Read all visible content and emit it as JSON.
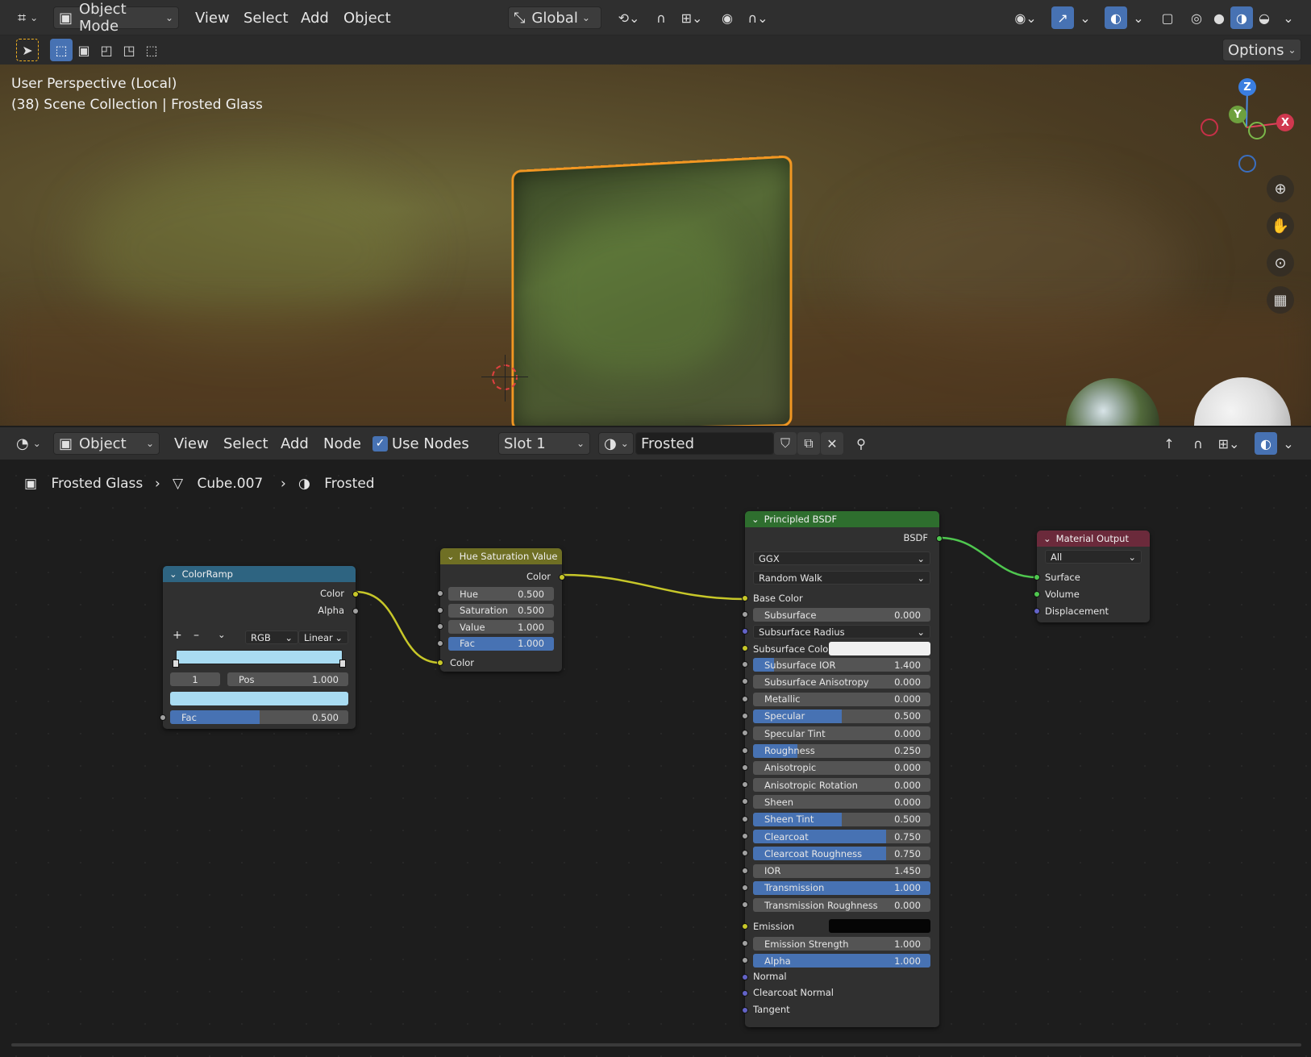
{
  "viewport_header": {
    "mode_label": "Object Mode",
    "menus": [
      "View",
      "Select",
      "Add",
      "Object"
    ],
    "orientation_label": "Global",
    "options_label": "Options"
  },
  "viewport": {
    "overlay_line1": "User Perspective (Local)",
    "overlay_line2": "(38) Scene Collection | Frosted Glass",
    "gizmo": {
      "z": "Z",
      "y": "Y",
      "x": "X"
    },
    "selection_color": "#f29722"
  },
  "node_editor_header": {
    "object_label": "Object",
    "menus": [
      "View",
      "Select",
      "Add",
      "Node"
    ],
    "use_nodes_label": "Use Nodes",
    "use_nodes_checked": true,
    "slot_label": "Slot 1",
    "material_name": "Frosted"
  },
  "breadcrumb": {
    "object": "Frosted Glass",
    "mesh": "Cube.007",
    "material": "Frosted"
  },
  "nodes": {
    "colorramp": {
      "title": "ColorRamp",
      "out_color": "Color",
      "out_alpha": "Alpha",
      "add": "+",
      "remove": "–",
      "color_mode": "RGB",
      "interpolation": "Linear",
      "stop_index": "1",
      "pos_label": "Pos",
      "pos_value": "1.000",
      "ramp_color": "#a9dcf2",
      "fac_label": "Fac",
      "fac_value": "0.500",
      "fac_fill": 0.5
    },
    "hsv": {
      "title": "Hue Saturation Value",
      "out_color": "Color",
      "fields": [
        {
          "label": "Hue",
          "value": "0.500",
          "fill": 0
        },
        {
          "label": "Saturation",
          "value": "0.500",
          "fill": 0
        },
        {
          "label": "Value",
          "value": "1.000",
          "fill": 0
        },
        {
          "label": "Fac",
          "value": "1.000",
          "fill": 1
        }
      ],
      "in_color": "Color"
    },
    "bsdf": {
      "title": "Principled BSDF",
      "out": "BSDF",
      "distribution": "GGX",
      "subsurface_method": "Random Walk",
      "base_color": "Base Color",
      "subsurface": {
        "label": "Subsurface",
        "value": "0.000",
        "fill": 0
      },
      "subsurface_radius": "Subsurface Radius",
      "subsurface_color": "Subsurface Color",
      "fields": [
        {
          "label": "Subsurface IOR",
          "value": "1.400",
          "fill": 0.12
        },
        {
          "label": "Subsurface Anisotropy",
          "value": "0.000",
          "fill": 0
        },
        {
          "label": "Metallic",
          "value": "0.000",
          "fill": 0
        },
        {
          "label": "Specular",
          "value": "0.500",
          "fill": 0.5
        },
        {
          "label": "Specular Tint",
          "value": "0.000",
          "fill": 0
        },
        {
          "label": "Roughness",
          "value": "0.250",
          "fill": 0.25
        },
        {
          "label": "Anisotropic",
          "value": "0.000",
          "fill": 0
        },
        {
          "label": "Anisotropic Rotation",
          "value": "0.000",
          "fill": 0
        },
        {
          "label": "Sheen",
          "value": "0.000",
          "fill": 0
        },
        {
          "label": "Sheen Tint",
          "value": "0.500",
          "fill": 0.5
        },
        {
          "label": "Clearcoat",
          "value": "0.750",
          "fill": 0.75
        },
        {
          "label": "Clearcoat Roughness",
          "value": "0.750",
          "fill": 0.75
        },
        {
          "label": "IOR",
          "value": "1.450",
          "fill": 0
        },
        {
          "label": "Transmission",
          "value": "1.000",
          "fill": 1
        },
        {
          "label": "Transmission Roughness",
          "value": "0.000",
          "fill": 0
        }
      ],
      "emission": "Emission",
      "emission_strength": {
        "label": "Emission Strength",
        "value": "1.000",
        "fill": 0
      },
      "alpha": {
        "label": "Alpha",
        "value": "1.000",
        "fill": 1
      },
      "normal": "Normal",
      "clearcoat_normal": "Clearcoat Normal",
      "tangent": "Tangent"
    },
    "output": {
      "title": "Material Output",
      "target": "All",
      "surface": "Surface",
      "volume": "Volume",
      "displacement": "Displacement"
    }
  },
  "colors": {
    "accent": "#4772b3",
    "colorramp_header": "#2e6481",
    "hsv_header": "#6f6f24",
    "bsdf_header": "#2e6e2e",
    "output_header": "#6b2a3b",
    "socket_color": "#c7c729",
    "socket_float": "#a1a1a1",
    "socket_shader": "#4fc74f",
    "socket_vector": "#6363c7"
  }
}
